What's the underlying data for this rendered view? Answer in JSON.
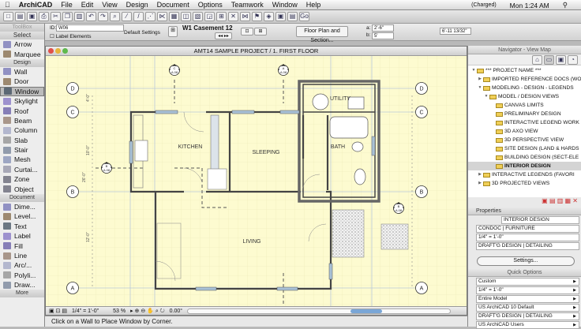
{
  "menubar": {
    "app": "ArchiCAD",
    "items": [
      "File",
      "Edit",
      "View",
      "Design",
      "Document",
      "Options",
      "Teamwork",
      "Window",
      "Help"
    ],
    "battery": "(Charged)",
    "clock": "Mon 1:24 AM"
  },
  "infobox": {
    "id_label": "ID:",
    "id_value": "W06",
    "label_elements": "Label Elements",
    "default_settings": "Default Settings",
    "window_name": "W1 Casement 12",
    "floor_plan_btn": "Floor Plan and Section...",
    "a_label": "a:",
    "a_value": "2'-6\"",
    "b_label": "b:",
    "b_value": "5'",
    "dimension": "6'-11 13/32\""
  },
  "toolbox": {
    "title": "ToolBox",
    "select": "Select",
    "design_header": "Design",
    "document_header": "Document",
    "more": "More",
    "select_tools": [
      "Arrow",
      "Marquee"
    ],
    "design_tools": [
      "Wall",
      "Door",
      "Window",
      "Skylight",
      "Roof",
      "Beam",
      "Column",
      "Slab",
      "Stair",
      "Mesh",
      "Curtai...",
      "Zone",
      "Object"
    ],
    "document_tools": [
      "Dime...",
      "Level...",
      "Text",
      "Label",
      "Fill",
      "Line",
      "Arc/...",
      "Polyli...",
      "Draw..."
    ],
    "selected": "Window"
  },
  "drawing": {
    "title": "AMT14 SAMPLE PROJECT / 1. FIRST FLOOR",
    "grid_labels": [
      "D",
      "C",
      "B",
      "A"
    ],
    "rooms": [
      "KITCHEN",
      "SLEEPING",
      "UTILITY",
      "BATH",
      "LIVING"
    ],
    "section_marker": "A.08",
    "section_letters": [
      "C",
      "A",
      "B",
      "B"
    ],
    "dims": [
      "4'-0\"",
      "10'-0\"",
      "12'-0\"",
      "26'-0\""
    ]
  },
  "bottombar": {
    "scale": "1/4\"  =  1'-0\"",
    "zoom": "53 %",
    "angle": "0.00°"
  },
  "status": "Click on a Wall to Place Window by Corner.",
  "navigator": {
    "title": "Navigator - View Map",
    "items": [
      {
        "label": "*** PROJECT NAME ***",
        "depth": 0
      },
      {
        "label": "IMPORTED REFERENCE DOCS (WOR",
        "depth": 1
      },
      {
        "label": "MODELING - DESIGN - LEGENDS",
        "depth": 1
      },
      {
        "label": "MODEL / DESIGN VIEWS",
        "depth": 2
      },
      {
        "label": "CANVAS LIMITS",
        "depth": 3
      },
      {
        "label": "PRELIMINARY DESIGN",
        "depth": 3
      },
      {
        "label": "INTERACTIVE LEGEND WORK",
        "depth": 3
      },
      {
        "label": "3D AXO VIEW",
        "depth": 3
      },
      {
        "label": "3D PERSPECTIVE VIEW",
        "depth": 3
      },
      {
        "label": "SITE DESIGN (LAND & HARDS",
        "depth": 3
      },
      {
        "label": "BUILDING DESIGN (SECT-ELE",
        "depth": 3
      },
      {
        "label": "INTERIOR DESIGN",
        "depth": 3,
        "selected": true
      },
      {
        "label": "INTERACTIVE LEGENDS (FAVORI",
        "depth": 1
      },
      {
        "label": "3D PROJECTED VIEWS",
        "depth": 1
      }
    ]
  },
  "properties": {
    "title": "Properties",
    "name": "INTERIOR DESIGN",
    "layer": "CONDOC | FURNITURE",
    "scale": "1/4\"  =  1'-0\"",
    "penset": "DRAFT'G DESIGN | DETAILING",
    "settings_btn": "Settings..."
  },
  "quick_options": {
    "title": "Quick Options",
    "rows": [
      "Custom",
      "1/4\"  =  1'-0\"",
      "Entire Model",
      "US ArchiCAD 10 Default",
      "DRAFT'G DESIGN | DETAILING",
      "US ArchiCAD Users"
    ]
  }
}
